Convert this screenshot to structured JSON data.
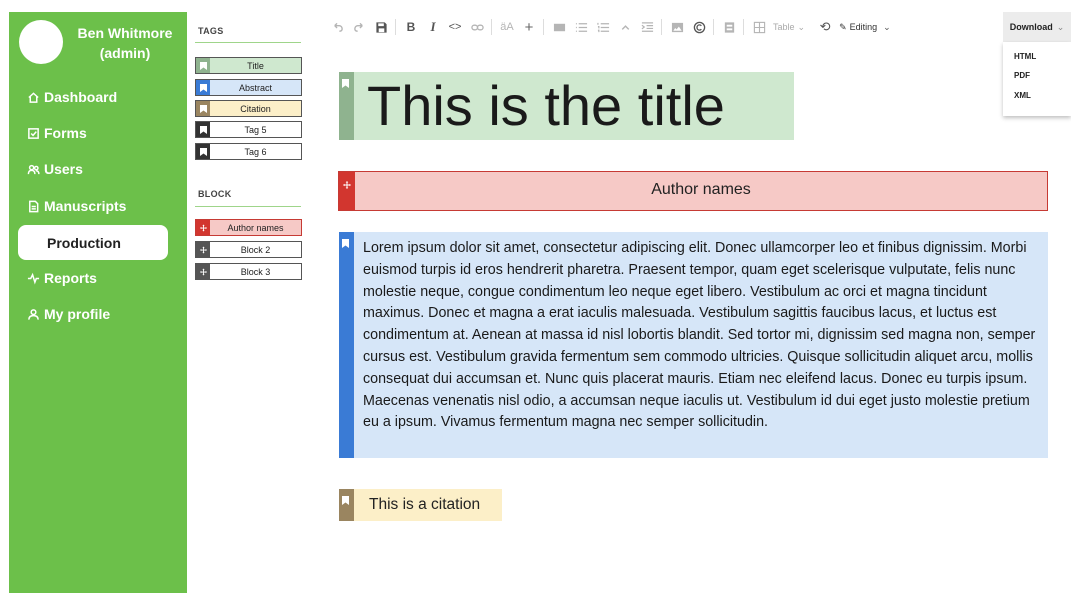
{
  "user": {
    "name": "Ben Whitmore",
    "role": "(admin)"
  },
  "nav": {
    "items": [
      {
        "label": "Dashboard",
        "icon": "home-icon"
      },
      {
        "label": "Forms",
        "icon": "checkbox-icon"
      },
      {
        "label": "Users",
        "icon": "users-icon"
      },
      {
        "label": "Manuscripts",
        "icon": "document-icon"
      },
      {
        "label": "Production",
        "icon": ""
      },
      {
        "label": "Reports",
        "icon": "activity-icon"
      },
      {
        "label": "My profile",
        "icon": "person-icon"
      }
    ],
    "active": "Production"
  },
  "tags_panel": {
    "tags_heading": "TAGS",
    "tags": [
      {
        "label": "Title",
        "color": "#cfe8cf",
        "swatch": "#8fb38f"
      },
      {
        "label": "Abstract",
        "color": "#d6e6f8",
        "swatch": "#3a7bd5"
      },
      {
        "label": "Citation",
        "color": "#fcefc8",
        "swatch": "#9a8560"
      },
      {
        "label": "Tag 5",
        "color": "#ffffff",
        "swatch": "#333333"
      },
      {
        "label": "Tag 6",
        "color": "#ffffff",
        "swatch": "#333333"
      }
    ],
    "block_heading": "BLOCK",
    "blocks": [
      {
        "label": "Author names",
        "color": "#f6c9c6",
        "swatch": "#d2362f"
      },
      {
        "label": "Block 2",
        "color": "#ffffff",
        "swatch": "#555555"
      },
      {
        "label": "Block 3",
        "color": "#ffffff",
        "swatch": "#555555"
      }
    ]
  },
  "toolbar": {
    "table_label": "Table",
    "editing_label": "Editing",
    "download_label": "Download",
    "download_options": [
      "HTML",
      "PDF",
      "XML"
    ]
  },
  "document": {
    "title": "This is the title",
    "author_names": "Author names",
    "abstract": "Lorem ipsum dolor sit amet, consectetur adipiscing elit. Donec ullamcorper leo et finibus dignissim. Morbi euismod turpis id eros hendrerit pharetra. Praesent tempor, quam eget scelerisque vulputate, felis nunc molestie neque, congue condimentum leo neque eget libero. Vestibulum ac orci et magna tincidunt maximus. Donec et magna a erat iaculis malesuada. Vestibulum sagittis faucibus lacus, et luctus est condimentum at. Aenean at massa id nisl lobortis blandit. Sed tortor mi, dignissim sed magna non, semper cursus est. Vestibulum gravida fermentum sem commodo ultricies. Quisque sollicitudin aliquet arcu, mollis consequat dui accumsan et. Nunc quis placerat mauris. Etiam nec eleifend lacus. Donec eu turpis ipsum. Maecenas venenatis nisl odio, a accumsan neque iaculis ut. Vestibulum id dui eget justo molestie pretium eu a ipsum. Vivamus fermentum magna nec semper sollicitudin.",
    "citation": "This is a citation"
  },
  "colors": {
    "sidebar": "#6cc04a",
    "title_bg": "#cfe8cf",
    "author_bg": "#f6c9c6",
    "author_border": "#c63a34",
    "abstract_bg": "#d6e6f8",
    "abstract_accent": "#3a7bd5",
    "citation_bg": "#fcefc8"
  }
}
